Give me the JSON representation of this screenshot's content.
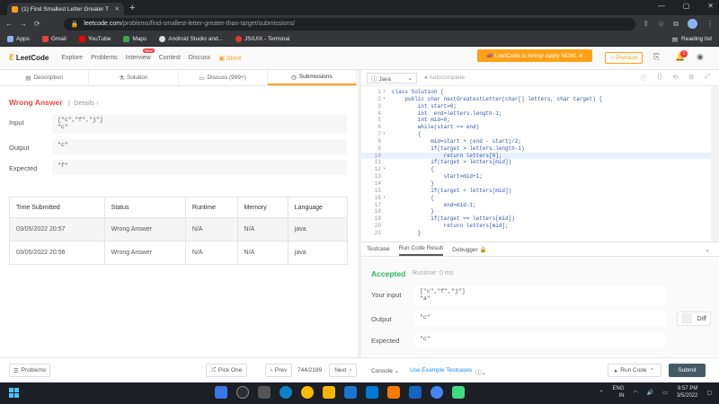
{
  "browser": {
    "tab_title": "(1) Find Smallest Letter Greater T",
    "url_domain": "leetcode.com",
    "url_path": "/problems/find-smallest-letter-greater-than-target/submissions/",
    "bookmarks": [
      "Apps",
      "Gmail",
      "YouTube",
      "Maps",
      "Android Studio and...",
      "JS/UIX - Terminal"
    ],
    "reading_list": "Reading list"
  },
  "nav": {
    "logo": "LeetCode",
    "items": [
      "Explore",
      "Problems",
      "Interview",
      "Contest",
      "Discuss"
    ],
    "new_badge": "New",
    "store": "Store",
    "hiring": "LeetCode is hiring! Apply NOW.",
    "premium": "Premium",
    "notif_count": "1"
  },
  "left_tabs": [
    "Description",
    "Solution",
    "Discuss (999+)",
    "Submissions"
  ],
  "submission": {
    "status": "Wrong Answer",
    "details": "Details",
    "input_label": "Input",
    "input": "[\"c\",\"f\",\"j\"]\n\"c\"",
    "output_label": "Output",
    "output": "\"c\"",
    "expected_label": "Expected",
    "expected": "\"f\""
  },
  "table": {
    "headers": [
      "Time Submitted",
      "Status",
      "Runtime",
      "Memory",
      "Language"
    ],
    "rows": [
      [
        "03/05/2022 20:57",
        "Wrong Answer",
        "N/A",
        "N/A",
        "java"
      ],
      [
        "03/05/2022 20:56",
        "Wrong Answer",
        "N/A",
        "N/A",
        "java"
      ]
    ]
  },
  "editor": {
    "language": "Java",
    "autocomplete": "Autocomplete",
    "lines": [
      "class Solution {",
      "    public char nextGreatestLetter(char[] letters, char target) {",
      "        int start=0;",
      "        int  end=letters.length-1;",
      "        int mid=0;",
      "        while(start <= end)",
      "        {",
      "            mid=start + (end - start)/2;",
      "            if(target > letters.length-1)",
      "                return letters[0];",
      "            if(target > letters[mid])",
      "            {",
      "                start=mid+1;",
      "            }",
      "            if(target < letters[mid])",
      "            {",
      "                end=mid-1;",
      "            }",
      "            if(target == letters[mid])",
      "                return letters[mid];",
      "        }"
    ]
  },
  "bottom_tabs": [
    "Testcase",
    "Run Code Result",
    "Debugger"
  ],
  "run_result": {
    "status": "Accepted",
    "runtime": "Runtime: 0 ms",
    "input_label": "Your input",
    "input": "[\"c\",\"f\",\"j\"]\n\"a\"",
    "output_label": "Output",
    "output": "\"c\"",
    "expected_label": "Expected",
    "expected": "\"c\"",
    "diff": "Diff"
  },
  "footer": {
    "problems": "Problems",
    "pick_one": "Pick One",
    "prev": "Prev",
    "counter": "744/2189",
    "next": "Next",
    "console": "Console",
    "example": "Use Example Testcases",
    "run": "Run Code",
    "submit": "Submit"
  },
  "taskbar": {
    "lang": "ENG",
    "region": "IN",
    "time": "8:57 PM",
    "date": "3/5/2022"
  }
}
